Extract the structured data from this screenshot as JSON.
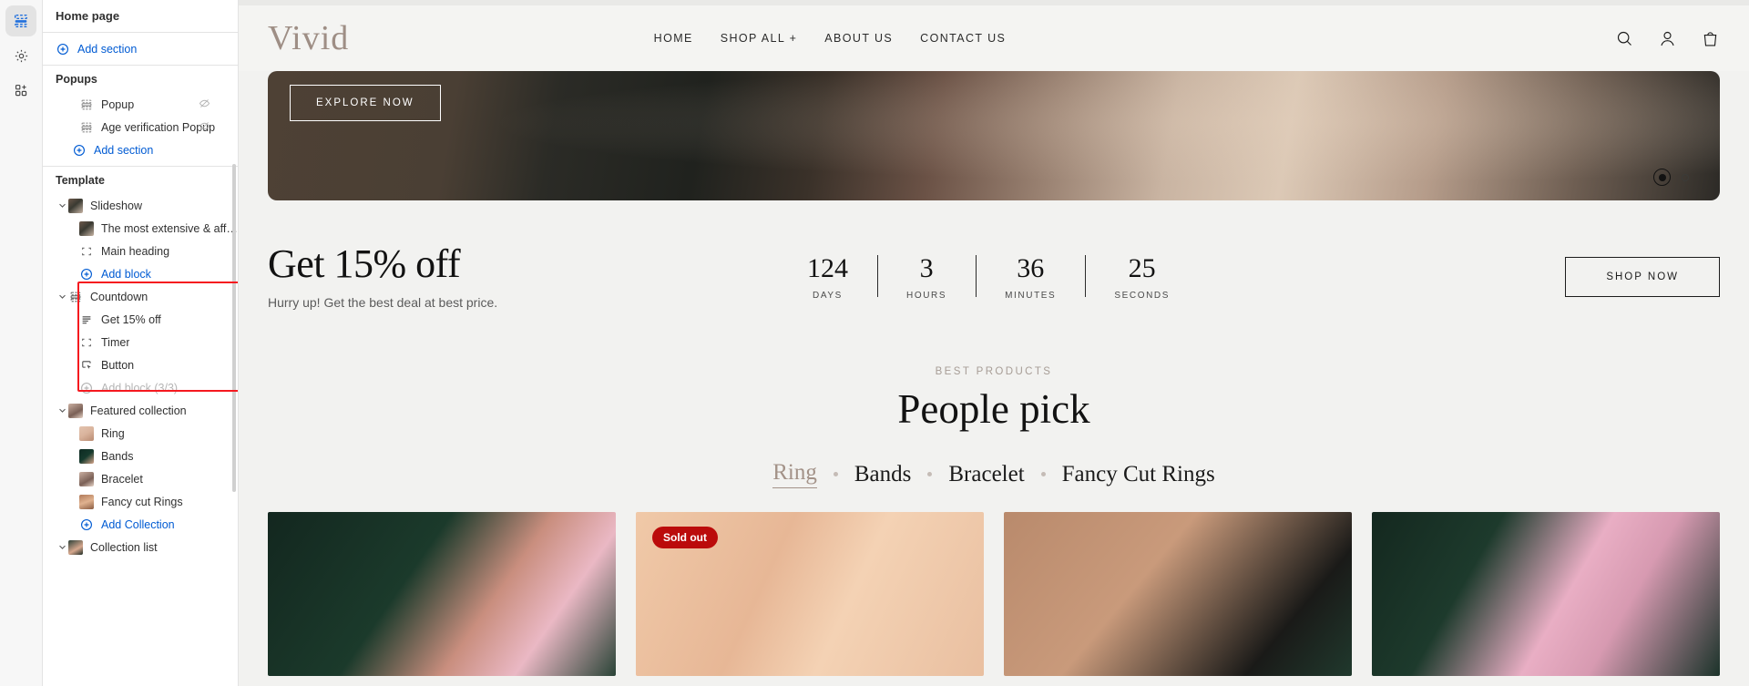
{
  "rail": {
    "items": [
      {
        "name": "sections-icon",
        "title": "Sections",
        "active": true
      },
      {
        "name": "gear-icon",
        "title": "Settings",
        "active": false
      },
      {
        "name": "apps-icon",
        "title": "Apps",
        "active": false
      }
    ]
  },
  "sidebar": {
    "header": "Home page",
    "add_section_top": "Add section",
    "popups_group": "Popups",
    "popups": [
      {
        "label": "Popup",
        "hidden": true
      },
      {
        "label": "Age verification Popup",
        "hidden": true
      }
    ],
    "add_section_popups": "Add section",
    "template_group": "Template",
    "slideshow": {
      "label": "Slideshow",
      "blocks": [
        {
          "label": "The most extensive & afforda...",
          "icon": "image-icon"
        },
        {
          "label": "Main heading",
          "icon": "text-frame-icon"
        }
      ],
      "add_block": "Add block"
    },
    "countdown": {
      "label": "Countdown",
      "blocks": [
        {
          "label": "Get 15% off",
          "icon": "text-lines-icon"
        },
        {
          "label": "Timer",
          "icon": "text-frame-icon"
        },
        {
          "label": "Button",
          "icon": "button-icon"
        }
      ],
      "add_block": "Add block (3/3)",
      "add_block_disabled": true,
      "highlight_color": "#f5191f"
    },
    "featured_collection": {
      "label": "Featured collection",
      "blocks": [
        {
          "label": "Ring"
        },
        {
          "label": "Bands"
        },
        {
          "label": "Bracelet"
        },
        {
          "label": "Fancy cut Rings"
        }
      ],
      "add_collection": "Add Collection"
    },
    "collection_list": {
      "label": "Collection list"
    }
  },
  "preview": {
    "brand": "Vivid",
    "nav": [
      {
        "label": "HOME"
      },
      {
        "label": "SHOP ALL +"
      },
      {
        "label": "ABOUT US"
      },
      {
        "label": "CONTACT US"
      }
    ],
    "header_icons": [
      {
        "name": "search-icon"
      },
      {
        "name": "account-icon"
      },
      {
        "name": "cart-icon"
      }
    ],
    "hero": {
      "cta": "EXPLORE NOW",
      "dots": [
        {
          "active": true
        },
        {
          "active": false
        }
      ]
    },
    "countdown": {
      "title": "Get 15% off",
      "subtitle": "Hurry up! Get the best deal at best price.",
      "units": [
        {
          "value": "124",
          "label": "DAYS"
        },
        {
          "value": "3",
          "label": "HOURS"
        },
        {
          "value": "36",
          "label": "MINUTES"
        },
        {
          "value": "25",
          "label": "SECONDS"
        }
      ],
      "cta": "SHOP NOW"
    },
    "best": {
      "kicker": "BEST PRODUCTS",
      "title": "People pick",
      "tabs": [
        {
          "label": "Ring",
          "active": true
        },
        {
          "label": "Bands",
          "active": false
        },
        {
          "label": "Bracelet",
          "active": false
        },
        {
          "label": "Fancy Cut Rings",
          "active": false
        }
      ]
    },
    "products": [
      {
        "badge": ""
      },
      {
        "badge": "Sold out"
      },
      {
        "badge": ""
      },
      {
        "badge": ""
      }
    ]
  }
}
